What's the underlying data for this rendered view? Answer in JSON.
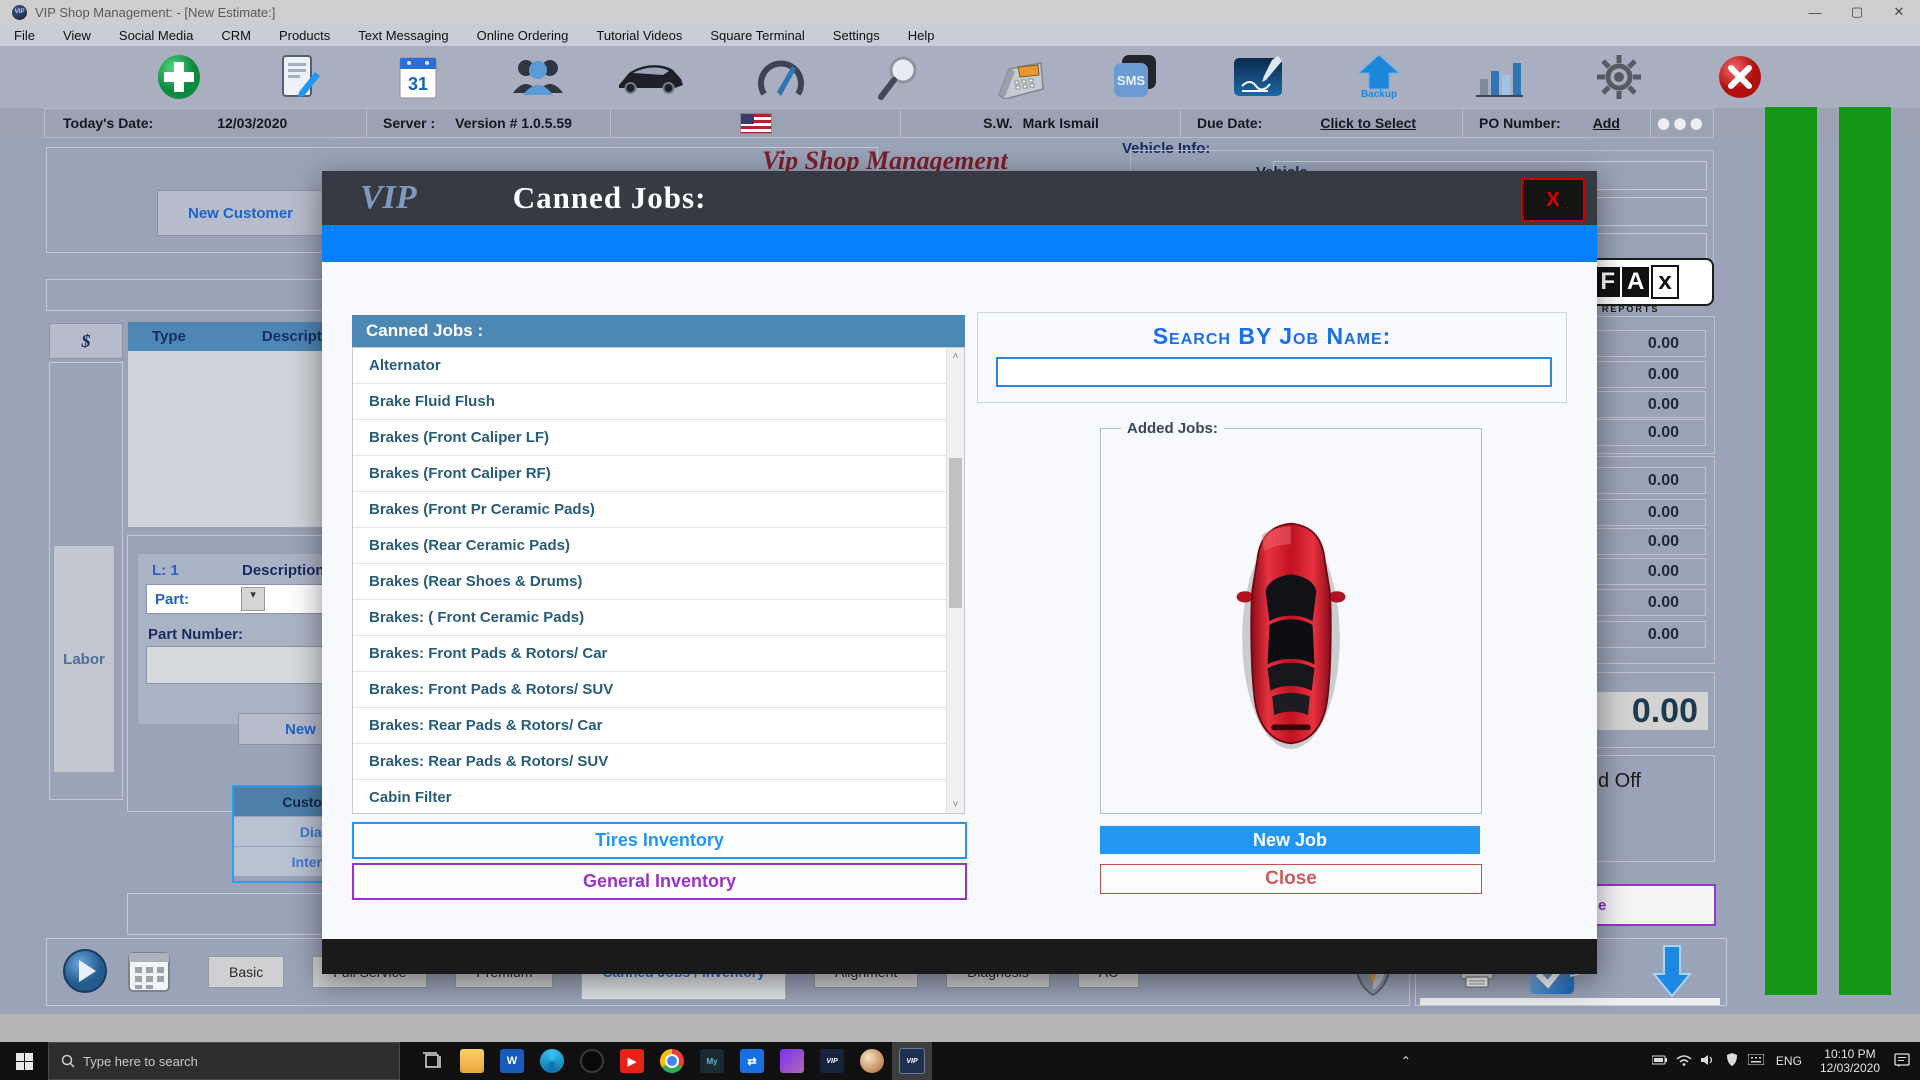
{
  "window": {
    "title": "VIP Shop Management:  - [New Estimate:]",
    "minimize": "—",
    "maximize": "▢",
    "close": "✕"
  },
  "menu": {
    "items": [
      "File",
      "View",
      "Social Media",
      "CRM",
      "Products",
      "Text Messaging",
      "Online Ordering",
      "Tutorial Videos",
      "Square Terminal",
      "Settings",
      "Help"
    ]
  },
  "toolbar": {
    "icons": [
      "new-estimate-icon",
      "edit-estimate-icon",
      "calendar-icon",
      "customers-icon",
      "vehicles-icon",
      "dashboard-gauge-icon",
      "search-icon",
      "fax-icon",
      "sms-icon",
      "signature-icon",
      "backup-icon",
      "reports-chart-icon",
      "settings-gear-icon",
      "exit-icon"
    ],
    "sms_label": "SMS",
    "backup_label": "Backup"
  },
  "infobar": {
    "today_label": "Today's Date:",
    "today_value": "12/03/2020",
    "server_label": "Server :",
    "version": "Version # 1.0.5.59",
    "sw_label": "S.W.",
    "sw_value": "Mark Ismail",
    "due_label": "Due Date:",
    "due_link": "Click to Select",
    "po_label": "PO Number:",
    "po_link": "Add",
    "dots": "⬤⬤⬤"
  },
  "background": {
    "script_title": "Vip Shop Management",
    "new_customer": "New Customer",
    "dollar": "$",
    "col_type": "Type",
    "col_description": "Description of Pa",
    "labor": "Labor",
    "line_label": "L: 1",
    "description_label": "Description",
    "part_label": "Part:",
    "part_dropdown": "▾",
    "part_number_label": "Part Number:",
    "new_button": "New",
    "left_tabs": [
      {
        "label": "Customer",
        "selected": true
      },
      {
        "label": "Diag",
        "selected": false
      },
      {
        "label": "Interna",
        "selected": false
      }
    ],
    "vehicle_info": "Vehicle Info:",
    "vehicle_partial": "Vehicle",
    "carfax": {
      "f": "F",
      "a": "A",
      "x": "x",
      "sub": "TORY REPORTS"
    },
    "amounts_group1": [
      "0.00",
      "0.00",
      "0.00",
      "0.00"
    ],
    "amounts_group2": [
      "0.00",
      "0.00",
      "0.00",
      "0.00",
      "0.00",
      "0.00"
    ],
    "total": "0.00",
    "signed_off_partial": "d Off",
    "purple_button_partial": "e",
    "bottom_tabs": [
      {
        "label": "Basic",
        "selected": false
      },
      {
        "label": "Full Service",
        "selected": false
      },
      {
        "label": "Premium",
        "selected": false
      },
      {
        "label": "Canned Jobs / Inventory",
        "selected": true
      },
      {
        "label": "Alignment",
        "selected": false
      },
      {
        "label": "Diagnosis",
        "selected": false
      },
      {
        "label": "AC",
        "selected": false
      }
    ]
  },
  "modal": {
    "logo": "VIP",
    "title": "Canned Jobs:",
    "close": "X",
    "list_header": "Canned Jobs :",
    "jobs": [
      "Alternator",
      "Brake Fluid Flush",
      "Brakes (Front Caliper LF)",
      "Brakes (Front Caliper RF)",
      "Brakes (Front Pr Ceramic Pads)",
      "Brakes (Rear Ceramic Pads)",
      "Brakes (Rear Shoes & Drums)",
      "Brakes: ( Front Ceramic Pads)",
      "Brakes: Front Pads & Rotors/ Car",
      "Brakes: Front Pads & Rotors/ SUV",
      "Brakes: Rear Pads & Rotors/ Car",
      "Brakes: Rear Pads & Rotors/ SUV",
      "Cabin Filter"
    ],
    "scroll_up": "˄",
    "scroll_down": "˅",
    "tires_inventory": "Tires Inventory",
    "general_inventory": "General Inventory",
    "search_label": "Search BY Job Name:",
    "search_value": "",
    "added_jobs_label": "Added Jobs:",
    "new_job": "New Job",
    "close_button": "Close"
  },
  "taskbar": {
    "search_placeholder": "Type here to search",
    "app_icons": [
      "task-view-icon",
      "explorer-icon",
      "word-icon",
      "edge-icon",
      "obs-icon",
      "youtube-icon",
      "chrome-icon",
      "mysql-icon",
      "teamviewer-icon",
      "photos-icon",
      "vip-icon",
      "paint-icon",
      "vip-active-icon"
    ],
    "word_glyph": "W",
    "teamviewer_glyph": "⇄",
    "vip_glyph": "VIP",
    "tray_chevron": "⌃",
    "lang": "ENG",
    "time": "10:10 PM",
    "date": "12/03/2020"
  },
  "colors": {
    "accent_blue": "#2196f3",
    "steel_header": "#4d87b3",
    "purple": "#9933cc",
    "close_red": "#d10000",
    "green_bar": "#169616",
    "modal_header": "#363a43",
    "taskbar": "#101010"
  }
}
